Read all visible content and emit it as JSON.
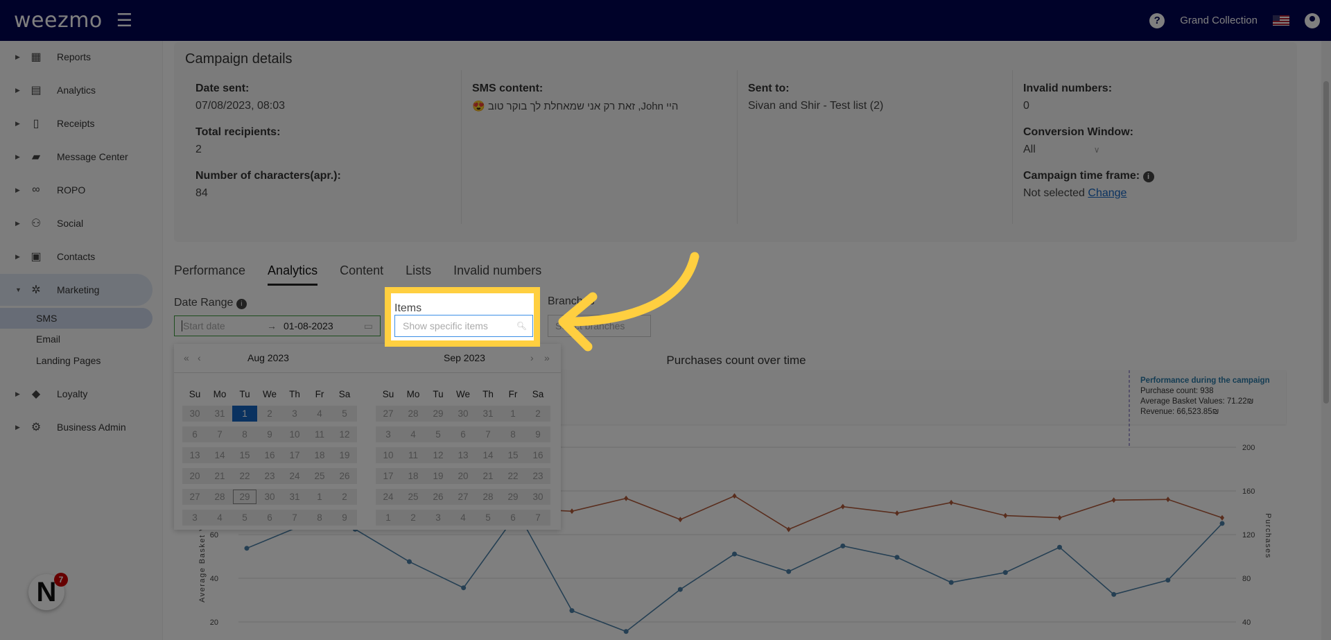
{
  "header": {
    "logo": "weezmo",
    "account": "Grand Collection"
  },
  "sidebar": {
    "items": [
      {
        "label": "Reports",
        "icon": "dashboard-icon"
      },
      {
        "label": "Analytics",
        "icon": "analytics-icon"
      },
      {
        "label": "Receipts",
        "icon": "receipt-icon"
      },
      {
        "label": "Message Center",
        "icon": "message-icon"
      },
      {
        "label": "ROPO",
        "icon": "infinity-icon"
      },
      {
        "label": "Social",
        "icon": "people-icon"
      },
      {
        "label": "Contacts",
        "icon": "contacts-icon"
      },
      {
        "label": "Marketing",
        "icon": "party-icon"
      },
      {
        "label": "Loyalty",
        "icon": "tag-icon"
      },
      {
        "label": "Business Admin",
        "icon": "gear-icon"
      }
    ],
    "sub": [
      "SMS",
      "Email",
      "Landing Pages"
    ],
    "notification_count": "7"
  },
  "campaign": {
    "title": "Campaign details",
    "date_sent_label": "Date sent:",
    "date_sent": "07/08/2023, 08:03",
    "recipients_label": "Total recipients:",
    "recipients": "2",
    "chars_label": "Number of characters(apr.):",
    "chars": "84",
    "sms_label": "SMS content:",
    "sms": "היי John, זאת רק אני שמאחלת לך בוקר טוב 😍",
    "sent_to_label": "Sent to:",
    "sent_to": "Sivan and Shir - Test list (2)",
    "invalid_label": "Invalid numbers:",
    "invalid": "0",
    "conv_label": "Conversion Window:",
    "conv": "All",
    "timeframe_label": "Campaign time frame:",
    "timeframe": "Not selected",
    "change": "Change"
  },
  "tabs": [
    "Performance",
    "Analytics",
    "Content",
    "Lists",
    "Invalid numbers"
  ],
  "filters": {
    "date_range_label": "Date Range",
    "start_placeholder": "Start date",
    "end_date": "01-08-2023",
    "items_label": "Items",
    "items_placeholder": "Show specific items",
    "branches_label": "Branches",
    "branches_placeholder": "Select branches"
  },
  "calendar": {
    "left_title": "Aug  2023",
    "right_title": "Sep  2023",
    "weekdays": [
      "Su",
      "Mo",
      "Tu",
      "We",
      "Th",
      "Fr",
      "Sa"
    ],
    "aug": [
      [
        "30",
        "31",
        "1",
        "2",
        "3",
        "4",
        "5"
      ],
      [
        "6",
        "7",
        "8",
        "9",
        "10",
        "11",
        "12"
      ],
      [
        "13",
        "14",
        "15",
        "16",
        "17",
        "18",
        "19"
      ],
      [
        "20",
        "21",
        "22",
        "23",
        "24",
        "25",
        "26"
      ],
      [
        "27",
        "28",
        "29",
        "30",
        "31",
        "1",
        "2"
      ],
      [
        "3",
        "4",
        "5",
        "6",
        "7",
        "8",
        "9"
      ]
    ],
    "sep": [
      [
        "27",
        "28",
        "29",
        "30",
        "31",
        "1",
        "2"
      ],
      [
        "3",
        "4",
        "5",
        "6",
        "7",
        "8",
        "9"
      ],
      [
        "10",
        "11",
        "12",
        "13",
        "14",
        "15",
        "16"
      ],
      [
        "17",
        "18",
        "19",
        "20",
        "21",
        "22",
        "23"
      ],
      [
        "24",
        "25",
        "26",
        "27",
        "28",
        "29",
        "30"
      ],
      [
        "1",
        "2",
        "3",
        "4",
        "5",
        "6",
        "7"
      ]
    ],
    "selected": "1",
    "today": "29"
  },
  "chart_data": {
    "type": "line",
    "title": "Purchases count over time",
    "ylabel_left": "Average Basket Value",
    "ylabel_right": "Purchases",
    "ylim_left": [
      0,
      100
    ],
    "ylim_right": [
      0,
      200
    ],
    "left_ticks": [
      "20",
      "40",
      "60"
    ],
    "right_ticks": [
      "40",
      "80",
      "120",
      "160",
      "200"
    ],
    "grid": true,
    "series": [
      {
        "axis": "right",
        "color": "#4a7fa6",
        "marker": "circle",
        "values": [
          107.5,
          128,
          124.9,
          95.2,
          71.3,
          140,
          50.4,
          31.3,
          69.8,
          102.2,
          86.2,
          109.6,
          99.2,
          76.2,
          85.3,
          108.4,
          65.2,
          78.3,
          130.2
        ]
      },
      {
        "axis": "left",
        "color": "#b35a3a",
        "marker": "diamond",
        "values": [
          72,
          70,
          73,
          71,
          74,
          72,
          70.7,
          76.6,
          66.9,
          77.7,
          62.4,
          72.8,
          69.8,
          74.7,
          68.7,
          67.7,
          75.8,
          76.1,
          67.7
        ]
      }
    ],
    "annotation": {
      "title": "Performance during the campaign",
      "lines": [
        "Purchase count: 938",
        "Average Basket Values: 71.22₪",
        "Revenue: 66,523.85₪"
      ]
    }
  },
  "colors": {
    "header": "#000452",
    "accent": "#1565c0",
    "highlight": "#ffcf40"
  }
}
